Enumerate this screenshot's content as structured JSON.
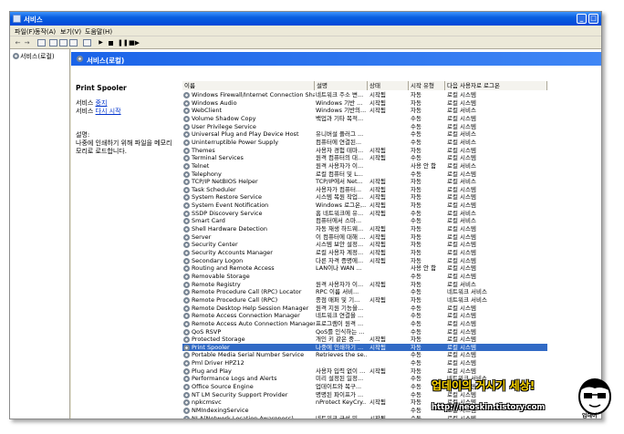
{
  "window": {
    "title": "서비스",
    "minimize_glyph": "_",
    "maximize_glyph": "□"
  },
  "menu": [
    "파일(F)",
    "동작(A)",
    "보기(V)",
    "도움말(H)"
  ],
  "toolbar_icons": [
    "back-arrow-icon",
    "forward-arrow-icon",
    "console-tree-icon",
    "properties-icon",
    "refresh-icon",
    "export-list-icon",
    "help-icon",
    "play-icon",
    "stop-icon",
    "pause-icon",
    "restart-icon"
  ],
  "tree": {
    "root": "서비스(로컬)"
  },
  "panel": {
    "title": "서비스(로컬)",
    "selected_service": "Print Spooler",
    "link_prefix_1": "서비스 ",
    "link_1": "중지",
    "link_prefix_2": "서비스 ",
    "link_2": "다시 시작",
    "desc_label": "설명:",
    "description": "나중에 인쇄하기 위해 파일을 메모리 모리로 로드합니다."
  },
  "columns": [
    "이름",
    "설명",
    "상태",
    "시작 유형",
    "다음 사용자로 로그온"
  ],
  "rows": [
    [
      "Windows Firewall/Internet Connection Shari...",
      "네트워크 주소 변...",
      "시작됨",
      "자동",
      "로컬 시스템"
    ],
    [
      "Windows Audio",
      "Windows 기반 ...",
      "시작됨",
      "자동",
      "로컬 시스템"
    ],
    [
      "WebClient",
      "Windows 기반의...",
      "시작됨",
      "자동",
      "로컬 서비스"
    ],
    [
      "Volume Shadow Copy",
      "백업과 기타 목적...",
      "",
      "수동",
      "로컬 시스템"
    ],
    [
      "User Privilege Service",
      "",
      "",
      "수동",
      "로컬 시스템"
    ],
    [
      "Universal Plug and Play Device Host",
      "유니버설 플러그 ...",
      "",
      "수동",
      "로컬 서비스"
    ],
    [
      "Uninterruptible Power Supply",
      "컴퓨터에 연결된...",
      "",
      "수동",
      "로컬 서비스"
    ],
    [
      "Themes",
      "사용자 경험 테마...",
      "시작됨",
      "자동",
      "로컬 시스템"
    ],
    [
      "Terminal Services",
      "원격 컴퓨터의 대...",
      "시작됨",
      "수동",
      "로컬 시스템"
    ],
    [
      "Telnet",
      "원격 사용자가 이...",
      "",
      "사용 안 함",
      "로컬 서비스"
    ],
    [
      "Telephony",
      "로컬 컴퓨터 및 L...",
      "",
      "수동",
      "로컬 시스템"
    ],
    [
      "TCP/IP NetBIOS Helper",
      "TCP/IP에서 Net...",
      "시작됨",
      "자동",
      "로컬 서비스"
    ],
    [
      "Task Scheduler",
      "사용자가 컴퓨터...",
      "시작됨",
      "자동",
      "로컬 시스템"
    ],
    [
      "System Restore Service",
      "시스템 복원 작업...",
      "시작됨",
      "자동",
      "로컬 시스템"
    ],
    [
      "System Event Notification",
      "Windows 로그온,...",
      "시작됨",
      "자동",
      "로컬 시스템"
    ],
    [
      "SSDP Discovery Service",
      "홈 네트워크에 유...",
      "시작됨",
      "수동",
      "로컬 서비스"
    ],
    [
      "Smart Card",
      "컴퓨터에서 스마...",
      "",
      "수동",
      "로컬 서비스"
    ],
    [
      "Shell Hardware Detection",
      "자동 재생 하드웨...",
      "시작됨",
      "자동",
      "로컬 시스템"
    ],
    [
      "Server",
      "이 컴퓨터에 대해 ...",
      "시작됨",
      "자동",
      "로컬 시스템"
    ],
    [
      "Security Center",
      "시스템 보안 설정...",
      "시작됨",
      "자동",
      "로컬 시스템"
    ],
    [
      "Security Accounts Manager",
      "로컬 사용자 계정...",
      "시작됨",
      "자동",
      "로컬 시스템"
    ],
    [
      "Secondary Logon",
      "다른 자격 증명에...",
      "시작됨",
      "자동",
      "로컬 시스템"
    ],
    [
      "Routing and Remote Access",
      "LAN이나 WAN ...",
      "",
      "사용 안 함",
      "로컬 시스템"
    ],
    [
      "Removable Storage",
      "",
      "",
      "수동",
      "로컬 시스템"
    ],
    [
      "Remote Registry",
      "원격 사용자가 이...",
      "시작됨",
      "자동",
      "로컬 서비스"
    ],
    [
      "Remote Procedure Call (RPC) Locator",
      "RPC 이름 서비...",
      "",
      "수동",
      "네트워크 서비스"
    ],
    [
      "Remote Procedure Call (RPC)",
      "종점 매퍼 및 기...",
      "시작됨",
      "자동",
      "네트워크 서비스"
    ],
    [
      "Remote Desktop Help Session Manager",
      "원격 지원 기능을...",
      "",
      "수동",
      "로컬 시스템"
    ],
    [
      "Remote Access Connection Manager",
      "네트워크 연결을 ...",
      "",
      "수동",
      "로컬 시스템"
    ],
    [
      "Remote Access Auto Connection Manager",
      "프로그램이 원격 ...",
      "",
      "수동",
      "로컬 시스템"
    ],
    [
      "QoS RSVP",
      "QoS를 인식하는 ...",
      "",
      "수동",
      "로컬 시스템"
    ],
    [
      "Protected Storage",
      "개인 키 같은 중...",
      "시작됨",
      "자동",
      "로컬 시스템"
    ],
    [
      "Print Spooler",
      "나중에 인쇄하기 ...",
      "시작됨",
      "자동",
      "로컬 시스템"
    ],
    [
      "Portable Media Serial Number Service",
      "Retrieves the se...",
      "",
      "수동",
      "로컬 시스템"
    ],
    [
      "Pml Driver HPZ12",
      "",
      "",
      "수동",
      "로컬 시스템"
    ],
    [
      "Plug and Play",
      "사용자 입력 없이 ...",
      "시작됨",
      "자동",
      "로컬 시스템"
    ],
    [
      "Performance Logs and Alerts",
      "미리 설정된 일정...",
      "",
      "수동",
      "네트워크 서비스"
    ],
    [
      "Office Source Engine",
      "업데이트와 복구...",
      "",
      "수동",
      "로컬 시스템"
    ],
    [
      "NT LM Security Support Provider",
      "명명된 파이프가 ...",
      "",
      "수동",
      "로컬 시스템"
    ],
    [
      "npkcmsvc",
      "nProtect KeyCry...",
      "시작됨",
      "자동",
      "로컬 시스템"
    ],
    [
      "NMIndexingService",
      "",
      "",
      "수동",
      "로컬 시스템"
    ],
    [
      "NLA(Network Location Awareness)",
      "네트워크 구성 및...",
      "시작됨",
      "수동",
      "로컬 시스템"
    ]
  ],
  "selected_index": 32,
  "watermark": {
    "line1": "업데이의 거시기 세상!",
    "line2": "http://neoskin.tistory.com",
    "caption": "업데이"
  },
  "colors": {
    "title_bar": "#0a5fe0",
    "selection": "#316ac5",
    "band": "#1a63e8",
    "link": "#0033cc",
    "watermark_yellow": "#ffd800"
  }
}
